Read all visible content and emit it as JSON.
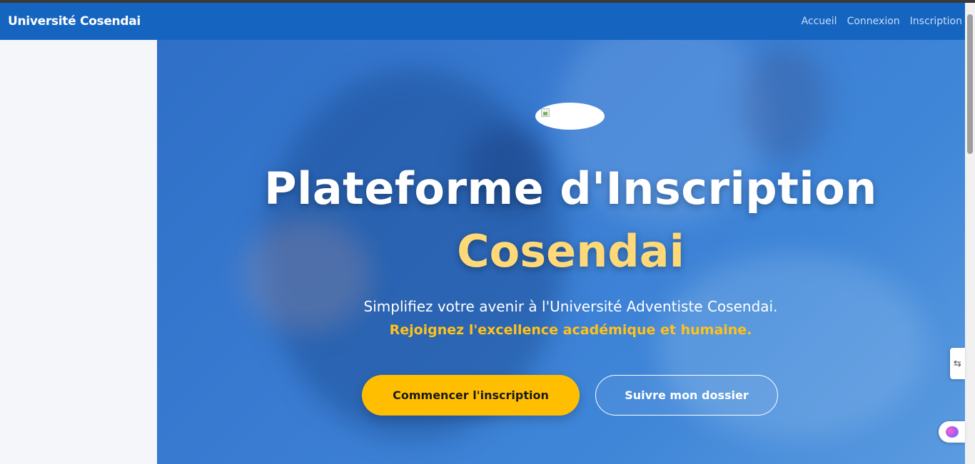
{
  "navbar": {
    "brand": "Université Cosendai",
    "links": [
      "Accueil",
      "Connexion",
      "Inscription"
    ]
  },
  "hero": {
    "title_line1": "Plateforme d'Inscription",
    "title_line2": "Cosendai",
    "subtitle": "Simplifiez votre avenir à l'Université Adventiste Cosendai.",
    "tagline": "Rejoignez l'excellence académique et humaine.",
    "primary_button": "Commencer l'inscription",
    "secondary_button": "Suivre mon dossier"
  },
  "widgets": {
    "side_tab_icon": "arrows-icon",
    "assistant_icon": "brain-icon"
  },
  "colors": {
    "navbar": "#1565c0",
    "accent_yellow": "#ffbf00",
    "title_highlight": "#ffd978"
  }
}
